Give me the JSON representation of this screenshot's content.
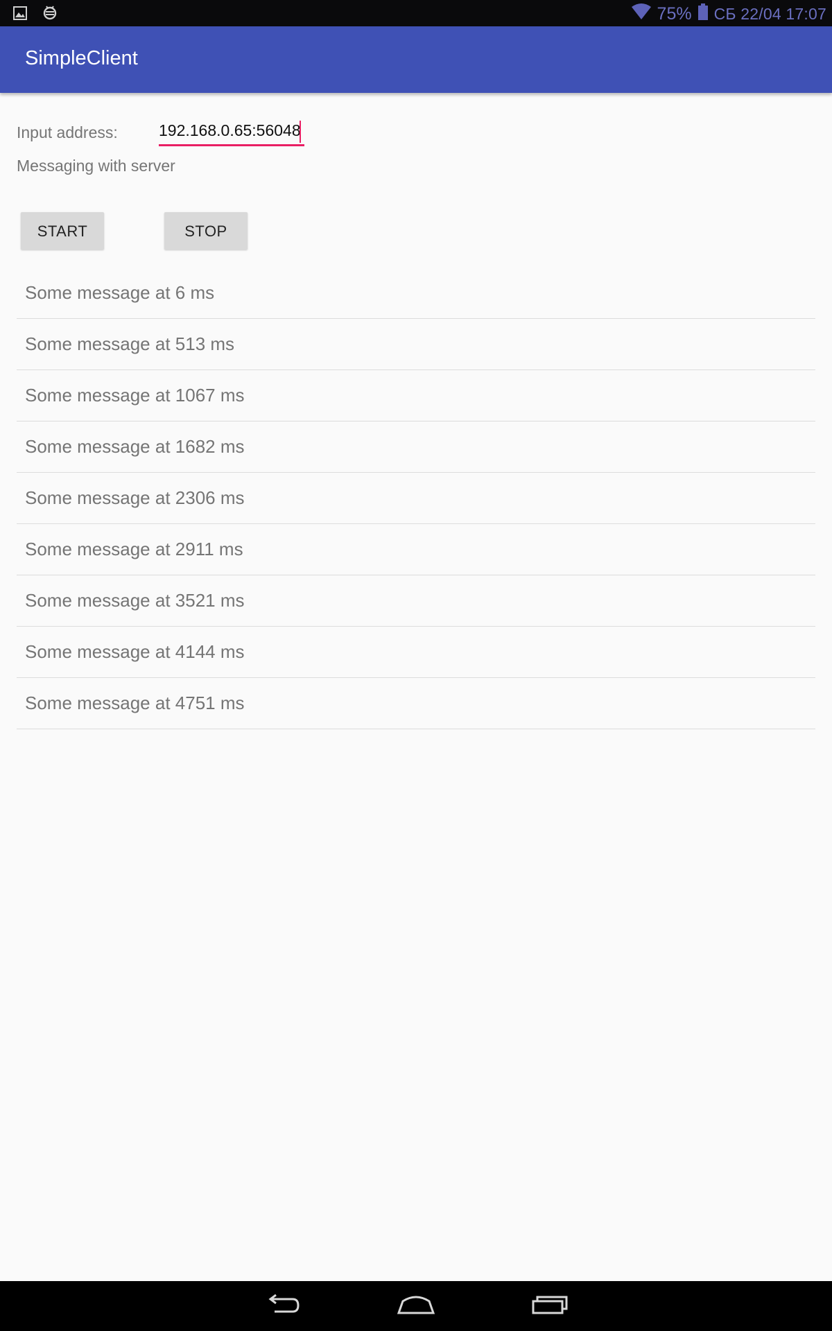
{
  "status_bar": {
    "battery_percent": "75%",
    "datetime": "СБ 22/04 17:07",
    "left_icons": [
      "image-icon",
      "debug-bug-icon"
    ],
    "right_icons": [
      "wifi-icon",
      "battery-icon"
    ],
    "colors": {
      "background": "#0a0a0c",
      "text": "#6a6fc0"
    }
  },
  "app_bar": {
    "title": "SimpleClient",
    "color": "#3f51b5"
  },
  "form": {
    "address_label": "Input address:",
    "address_value": "192.168.0.65:56048",
    "status_text": "Messaging with server",
    "start_label": "START",
    "stop_label": "STOP",
    "accent_color": "#e91e63"
  },
  "messages": [
    "Some message at 6 ms",
    "Some message at 513 ms",
    "Some message at 1067 ms",
    "Some message at 1682 ms",
    "Some message at 2306 ms",
    "Some message at 2911 ms",
    "Some message at 3521 ms",
    "Some message at 4144 ms",
    "Some message at 4751 ms"
  ],
  "nav_bar": {
    "buttons": [
      "back-icon",
      "home-icon",
      "recent-apps-icon"
    ]
  }
}
